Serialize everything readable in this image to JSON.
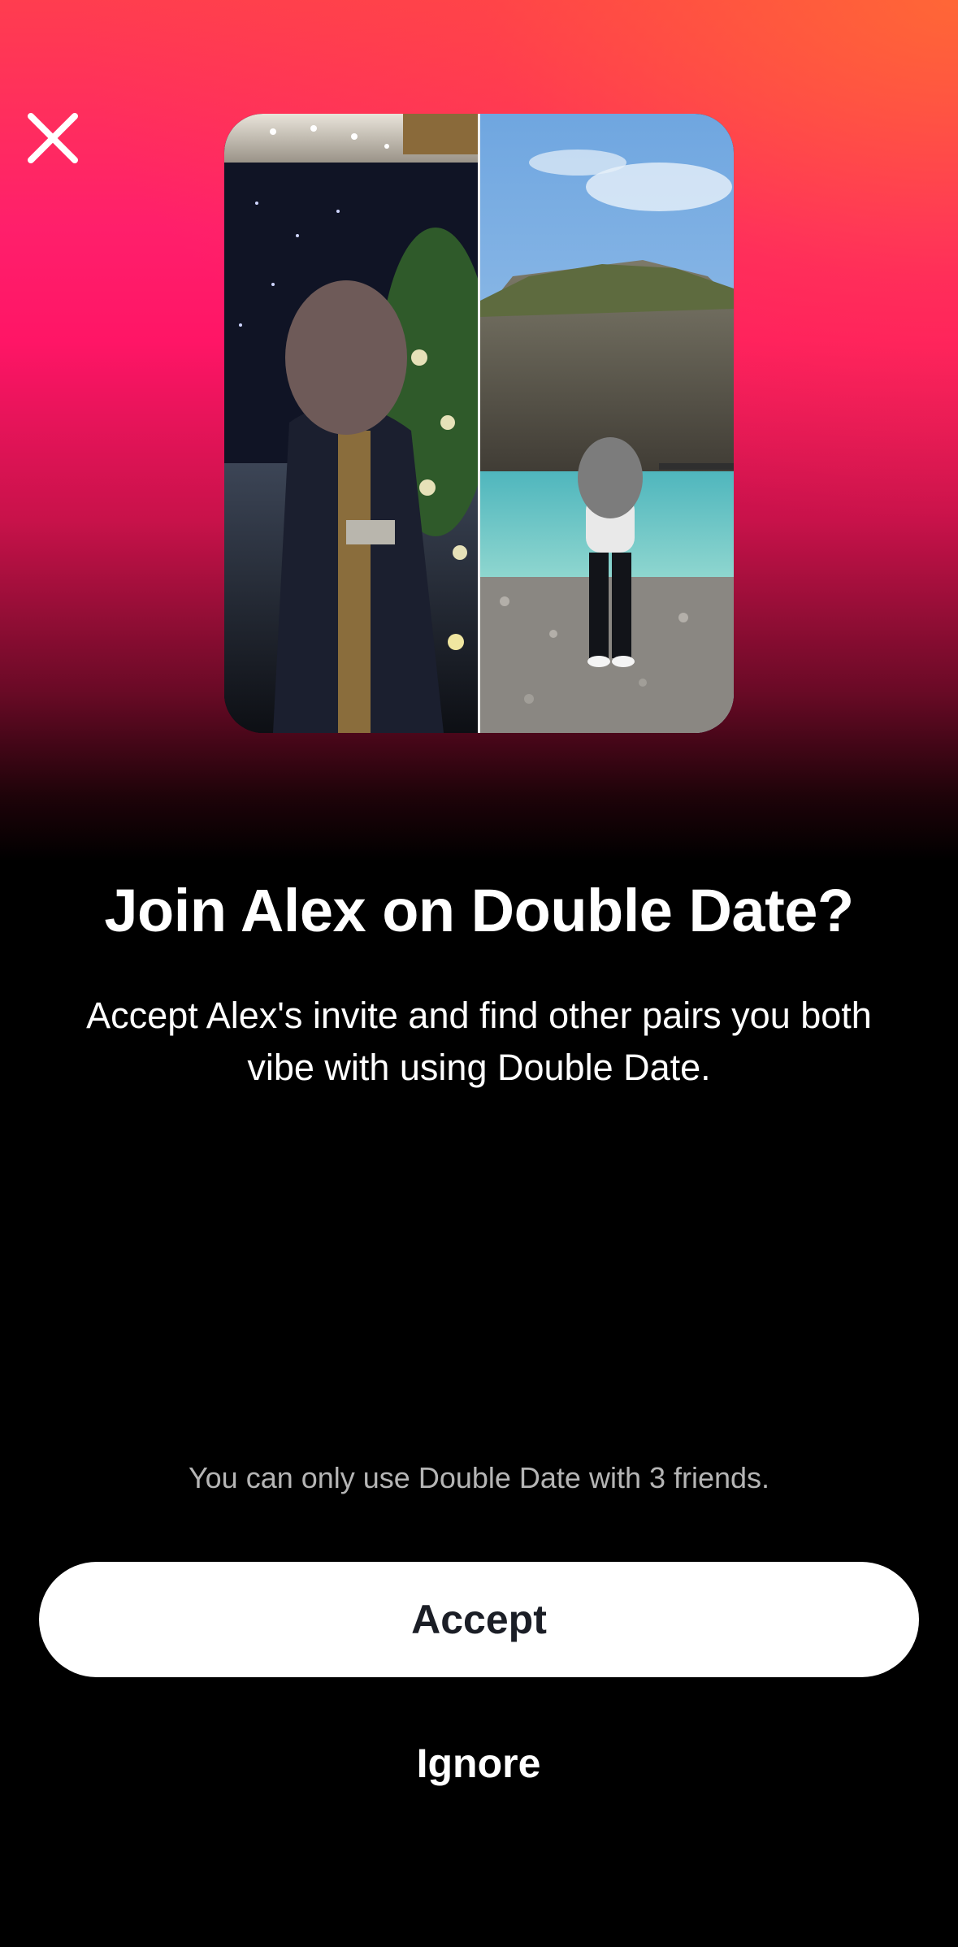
{
  "header": {
    "close_icon": "close-icon"
  },
  "photos": [
    {
      "icon": "profile-photo-left"
    },
    {
      "icon": "profile-photo-right"
    }
  ],
  "content": {
    "title": "Join Alex on Double Date?",
    "subtitle": "Accept Alex's invite and find other pairs you both vibe with using Double Date."
  },
  "footer": {
    "limit_note": "You can only use Double Date with 3 friends.",
    "accept_label": "Accept",
    "ignore_label": "Ignore"
  },
  "colors": {
    "accent_gradient_top": "#ff3d4f",
    "accent_gradient_mid": "#ff1566",
    "background": "#000000",
    "accept_button_bg": "#ffffff",
    "accept_button_text": "#1b1e26",
    "note_text": "#b5b5b5"
  }
}
